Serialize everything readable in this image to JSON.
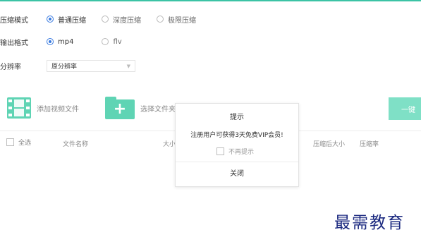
{
  "compress_mode": {
    "label": "压缩模式",
    "options": [
      "普通压缩",
      "深度压缩",
      "极限压缩"
    ],
    "selected": "普通压缩"
  },
  "output_format": {
    "label": "输出格式",
    "options": [
      "mp4",
      "flv"
    ],
    "selected": "mp4"
  },
  "resolution": {
    "label": "分辨率",
    "value": "原分辨率"
  },
  "toolbar": {
    "add_video": "添加视频文件",
    "select_folder": "选择文件夹",
    "compress_button": "一键"
  },
  "table": {
    "select_all": "全选",
    "columns": [
      "文件名称",
      "大小",
      "压缩后大小",
      "压缩率"
    ]
  },
  "dialog": {
    "title": "提示",
    "message": "注册用户可获得3天免费VIP会员!",
    "no_remind": "不再提示",
    "close": "关闭"
  },
  "watermark": "最需教育",
  "colors": {
    "accent": "#3cc3a5",
    "icon": "#5fd4b4",
    "radio_selected": "#3a7be0",
    "watermark": "#1c2a80"
  }
}
